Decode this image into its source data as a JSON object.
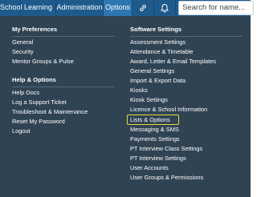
{
  "navbar": {
    "items": [
      "School",
      "Learning",
      "Administration",
      "Options"
    ],
    "active": "Options",
    "search_placeholder": "Search for name..."
  },
  "menu": {
    "left": {
      "sections": [
        {
          "heading": "My Preferences",
          "items": [
            "General",
            "Security",
            "Mentor Groups & Pulse"
          ]
        },
        {
          "heading": "Help & Options",
          "items": [
            "Help Docs",
            "Log a Support Ticket",
            "Troubleshoot & Maintenance",
            "Reset My Password",
            "Logout"
          ]
        }
      ]
    },
    "right": {
      "heading": "Software Settings",
      "items": [
        "Assessment Settings",
        "Attendance & Timetable",
        "Award, Letter & Email Templates",
        "General Settings",
        "Import & Export Data",
        "Kiosks",
        "Kiosk Settings",
        "Licence & School Information",
        "Lists & Options",
        "Messaging & SMS",
        "Payments Settings",
        "PT Interview Class Settings",
        "PT Interview Settings",
        "User Accounts",
        "User Groups & Permissions"
      ],
      "highlighted": "Lists & Options"
    }
  },
  "colors": {
    "nav_bg": "#1f5a8c",
    "nav_active": "#2e76b2",
    "menu_bg": "#2f4353",
    "highlight": "#e8d73a"
  },
  "icons": [
    "link-icon",
    "bell-icon"
  ]
}
